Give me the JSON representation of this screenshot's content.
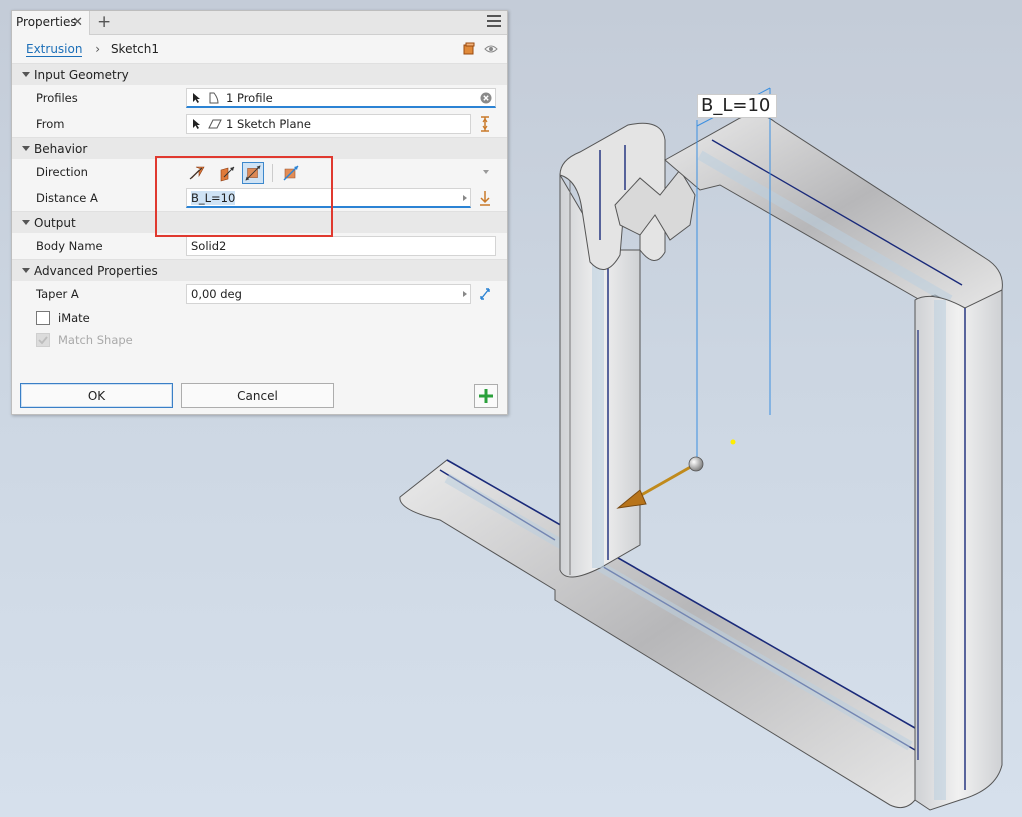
{
  "panel": {
    "tab_label": "Properties",
    "breadcrumb": {
      "link": "Extrusion",
      "current": "Sketch1"
    },
    "sections": {
      "input_geometry": "Input Geometry",
      "behavior": "Behavior",
      "output": "Output",
      "advanced": "Advanced Properties"
    },
    "fields": {
      "profiles": {
        "label": "Profiles",
        "value": "1 Profile"
      },
      "from": {
        "label": "From",
        "value": "1 Sketch Plane"
      },
      "direction": {
        "label": "Direction"
      },
      "distance_a": {
        "label": "Distance A",
        "value": "B_L=10"
      },
      "body_name": {
        "label": "Body Name",
        "value": "Solid2"
      },
      "taper_a": {
        "label": "Taper A",
        "value": "0,00 deg"
      }
    },
    "checks": {
      "imate": {
        "label": "iMate",
        "checked": false
      },
      "match_shape": {
        "label": "Match Shape",
        "checked": true,
        "disabled": true
      }
    },
    "buttons": {
      "ok": "OK",
      "cancel": "Cancel"
    }
  },
  "viewport": {
    "dimension_label": "B_L=10"
  },
  "colors": {
    "accent": "#1c6fb8",
    "highlight": "#e0392f",
    "add_green": "#2aa03b",
    "direction_orange": "#e07a3a"
  }
}
